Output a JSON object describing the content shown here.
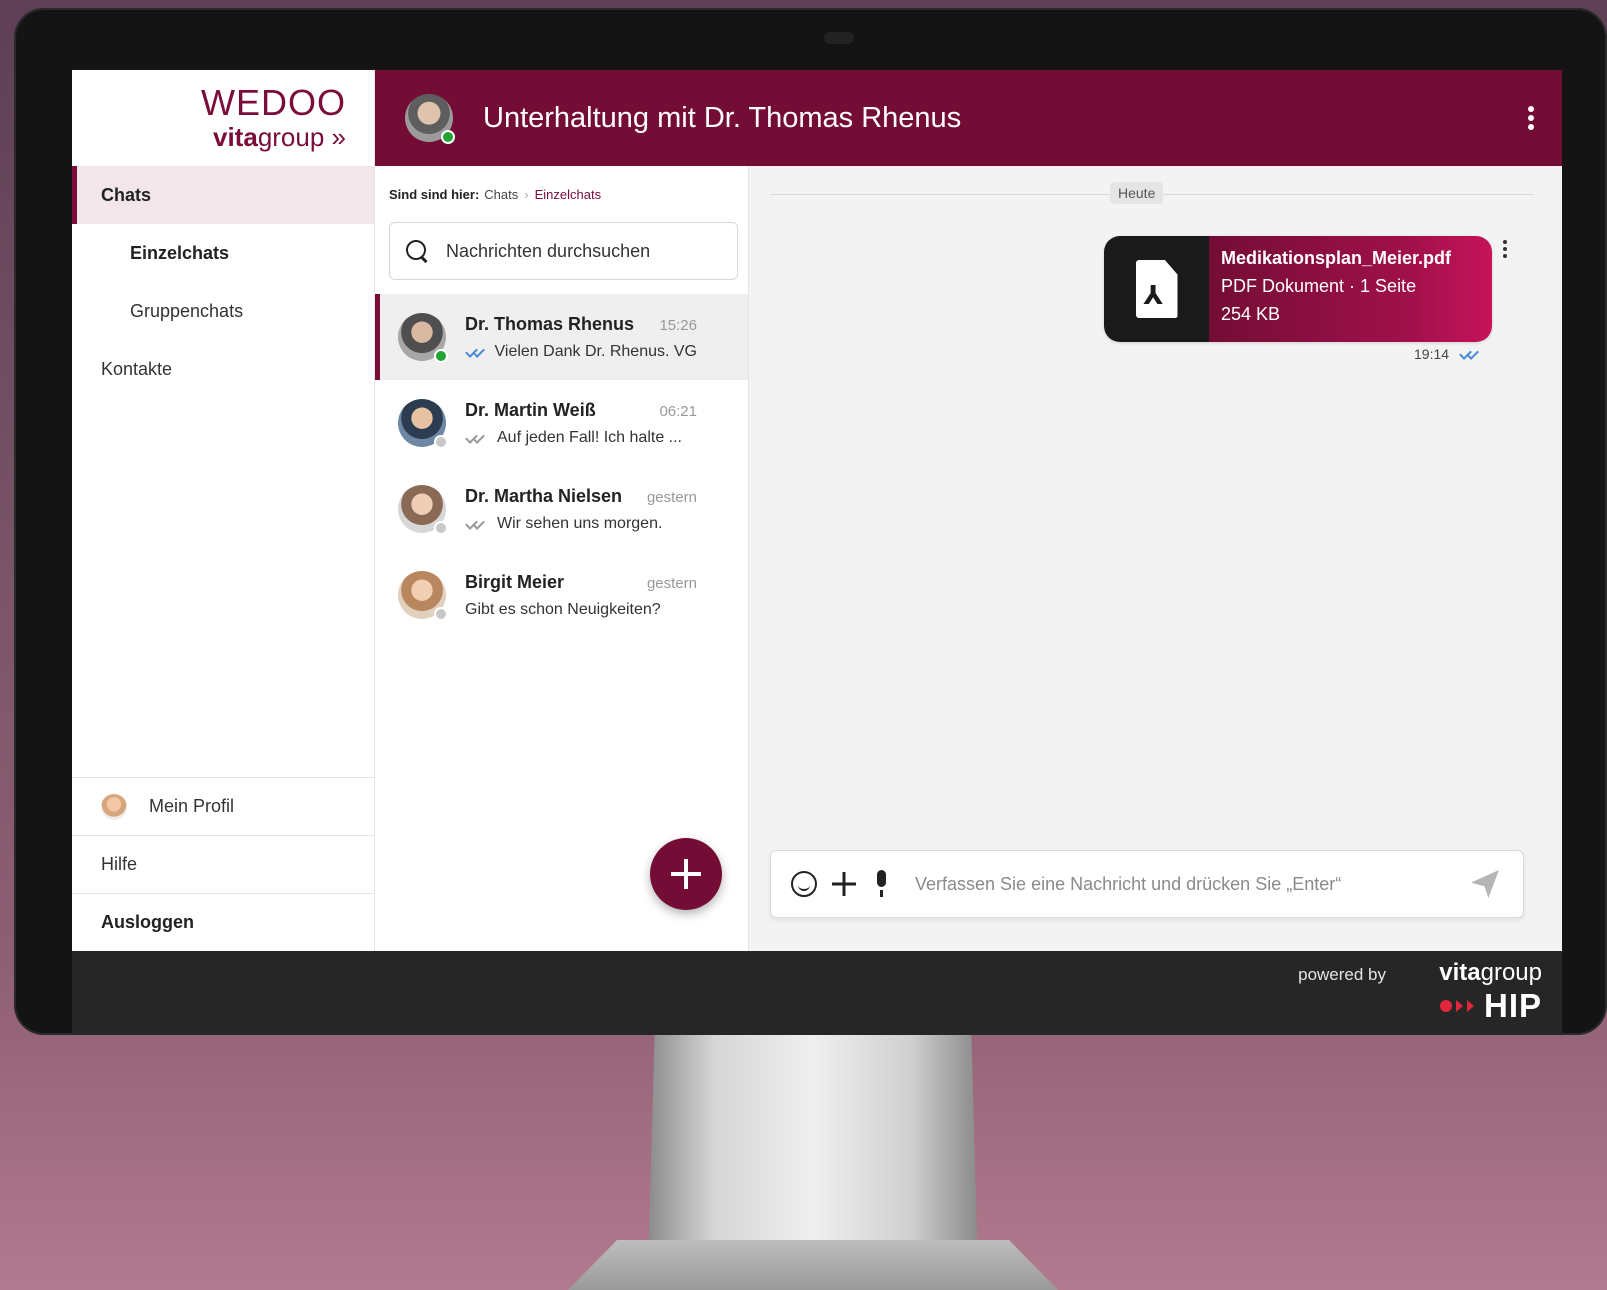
{
  "brand": {
    "logo_title": "WEDOO",
    "logo_sub_bold": "vita",
    "logo_sub_rest": "group »"
  },
  "sidebar": {
    "items": [
      {
        "label": "Chats"
      },
      {
        "label": "Einzelchats"
      },
      {
        "label": "Gruppenchats"
      },
      {
        "label": "Kontakte"
      }
    ],
    "bottom": {
      "profile": "Mein Profil",
      "help": "Hilfe",
      "logout": "Ausloggen"
    }
  },
  "header": {
    "title": "Unterhaltung mit Dr. Thomas Rhenus"
  },
  "breadcrumb": {
    "prefix": "Sind sind hier:",
    "parent": "Chats",
    "current": "Einzelchats"
  },
  "search": {
    "placeholder": "Nachrichten durchsuchen"
  },
  "chats": [
    {
      "name": "Dr. Thomas Rhenus",
      "time": "15:26",
      "message": "Vielen Dank Dr. Rhenus. VG",
      "status": "online",
      "ticks": "read"
    },
    {
      "name": "Dr. Martin Weiß",
      "time": "06:21",
      "message": "Auf jeden Fall! Ich halte ...",
      "status": "offline",
      "ticks": "delivered"
    },
    {
      "name": "Dr. Martha Nielsen",
      "time": "gestern",
      "message": "Wir sehen uns morgen.",
      "status": "offline",
      "ticks": "delivered"
    },
    {
      "name": "Birgit Meier",
      "time": "gestern",
      "message": "Gibt es schon Neuigkeiten?",
      "status": "offline",
      "ticks": "none"
    }
  ],
  "conversation": {
    "day_label": "Heute",
    "file": {
      "name": "Medikationsplan_Meier.pdf",
      "meta": "PDF Dokument · 1 Seite",
      "size": "254 KB"
    },
    "message_time": "19:14"
  },
  "composer": {
    "placeholder": "Verfassen Sie eine Nachricht und drücken Sie „Enter“"
  },
  "footer": {
    "powered_by": "powered by",
    "brand_bold": "vita",
    "brand_rest": "group",
    "brand_hip": "HIP"
  },
  "colors": {
    "primary": "#730d35",
    "online": "#21a530",
    "read_tick": "#4a8bd6"
  }
}
